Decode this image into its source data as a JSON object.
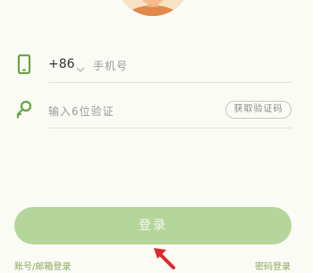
{
  "phone_row": {
    "icon": "phone-icon",
    "country_code": "+86",
    "dropdown_icon": "chevron-down-icon",
    "placeholder": "手机号"
  },
  "code_row": {
    "icon": "key-icon",
    "placeholder": "输入6位验证",
    "get_code_label": "获取验证码"
  },
  "login_button": {
    "label": "登录"
  },
  "bottom_links": {
    "left": "账号/邮箱登录",
    "right": "密码登录"
  },
  "colors": {
    "background": "#fbfbf5",
    "accent_green": "#6aa341",
    "button_green": "#b5d69a",
    "link_green": "#8aa85e",
    "annotation_red": "#e0262b"
  }
}
